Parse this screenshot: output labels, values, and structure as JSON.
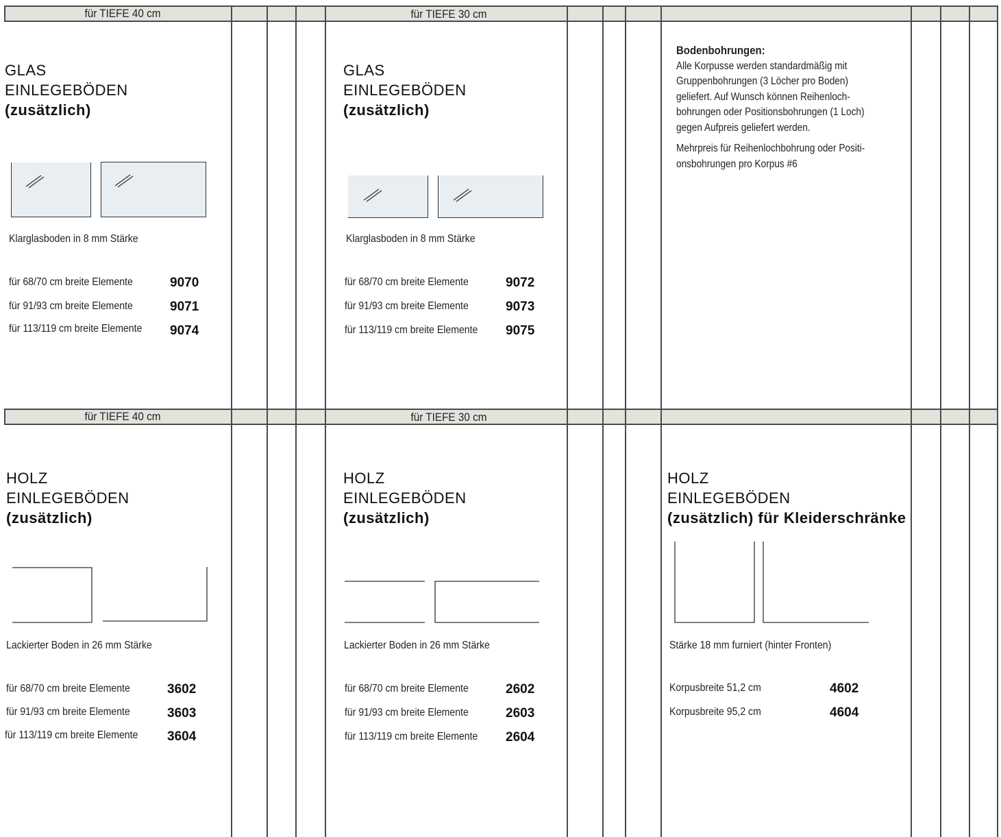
{
  "top": {
    "left": {
      "band_label": "für TIEFE 40 cm",
      "title_line1": "GLAS",
      "title_line2": "EINLEGEBÖDEN",
      "title_line3": "(zusätzlich)",
      "description": "Klarglasboden in 8 mm Stärke",
      "rows": [
        {
          "label": "für 68/70 cm breite Elemente",
          "code": "9070"
        },
        {
          "label": "für 91/93 cm breite Elemente",
          "code": "9071"
        },
        {
          "label": "für 113/119 cm breite Elemente",
          "code": "9074"
        }
      ]
    },
    "middle": {
      "band_label": "für TIEFE 30 cm",
      "title_line1": "GLAS",
      "title_line2": "EINLEGEBÖDEN",
      "title_line3": "(zusätzlich)",
      "description": "Klarglasboden in 8 mm Stärke",
      "rows": [
        {
          "label": "für 68/70 cm breite Elemente",
          "code": "9072"
        },
        {
          "label": "für 91/93 cm breite Elemente",
          "code": "9073"
        },
        {
          "label": "für 113/119 cm breite Elemente",
          "code": "9075"
        }
      ]
    },
    "right": {
      "heading": "Bodenbohrungen:",
      "paragraph1": [
        "Alle Korpusse werden standardmäßig mit",
        "Gruppenbohrungen (3 Löcher pro Boden)",
        "geliefert. Auf Wunsch können Reihenloch-",
        "bohrungen oder Positionsbohrungen (1 Loch)",
        "gegen Aufpreis geliefert werden."
      ],
      "paragraph2": [
        "Mehrpreis für Reihenlochbohrung oder Positi-",
        "onsbohrungen pro Korpus #6"
      ]
    }
  },
  "bottom": {
    "left": {
      "band_label": "für TIEFE 40 cm",
      "title_line1": "HOLZ",
      "title_line2": "EINLEGEBÖDEN",
      "title_line3": "(zusätzlich)",
      "description": "Lackierter Boden in 26 mm Stärke",
      "rows": [
        {
          "label": "für 68/70 cm breite Elemente",
          "code": "3602"
        },
        {
          "label": "für 91/93 cm breite Elemente",
          "code": "3603"
        },
        {
          "label": "für 113/119 cm breite Elemente",
          "code": "3604"
        }
      ]
    },
    "middle": {
      "band_label": "für TIEFE 30 cm",
      "title_line1": "HOLZ",
      "title_line2": "EINLEGEBÖDEN",
      "title_line3": "(zusätzlich)",
      "description": "Lackierter Boden in 26 mm Stärke",
      "rows": [
        {
          "label": "für 68/70 cm breite Elemente",
          "code": "2602"
        },
        {
          "label": "für 91/93 cm breite Elemente",
          "code": "2603"
        },
        {
          "label": "für 113/119 cm breite Elemente",
          "code": "2604"
        }
      ]
    },
    "right": {
      "title_line1": "HOLZ",
      "title_line2": "EINLEGEBÖDEN",
      "title_line3": "(zusätzlich) für Kleiderschränke",
      "description": "Stärke 18 mm furniert (hinter Fronten)",
      "rows": [
        {
          "label": "Korpusbreite 51,2 cm",
          "code": "4602"
        },
        {
          "label": "Korpusbreite 95,2 cm",
          "code": "4604"
        }
      ]
    }
  },
  "colors": {
    "band": "#e3e3de",
    "glass_fill": "#e8eef2",
    "rule": "#4a4a4a"
  }
}
